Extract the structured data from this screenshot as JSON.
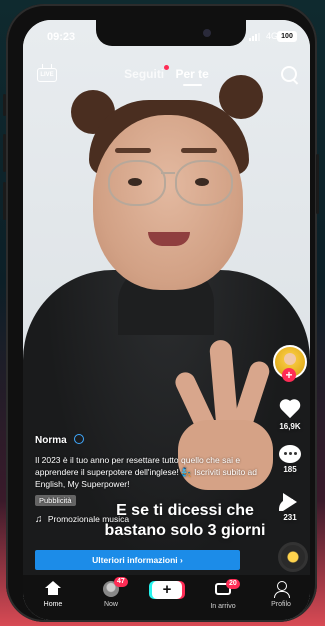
{
  "status_bar": {
    "time": "09:23",
    "network": "4G",
    "battery": "100"
  },
  "top_nav": {
    "live_label": "LIVE",
    "tabs": [
      {
        "label": "Seguiti",
        "active": false,
        "has_dot": true
      },
      {
        "label": "Per te",
        "active": true
      }
    ]
  },
  "rail": {
    "likes": "16,9K",
    "comments": "185",
    "shares": "231"
  },
  "post": {
    "username": "Norma",
    "description": "Il 2023 è il tuo anno per resettare tutto quello che sai e apprendere il superpotere dell'inglese! 🧞 Iscriviti subito ad English, My Superpower!",
    "ad_label": "Pubblicità",
    "music": "Promozionale musica",
    "overlay_text": "E se ti dicessi che bastano solo 3 giorni",
    "cta_label": "Ulteriori informazioni ›"
  },
  "bottom_nav": {
    "items": [
      {
        "label": "Home",
        "active": true
      },
      {
        "label": "Now",
        "badge": "47"
      },
      {
        "label": "+"
      },
      {
        "label": "In arrivo",
        "badge": "20"
      },
      {
        "label": "Profilo"
      }
    ]
  },
  "colors": {
    "accent": "#fe2c55",
    "cta": "#1c8ce8",
    "cyan": "#25f4ee"
  }
}
